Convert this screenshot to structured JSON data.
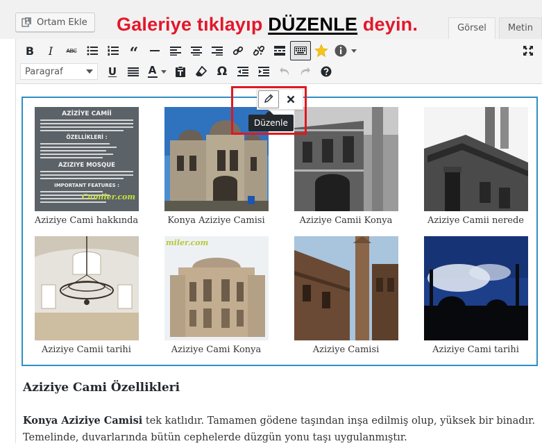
{
  "media_button": {
    "label": "Ortam Ekle",
    "icon": "media-icon"
  },
  "instruction": {
    "before": "Galeriye tıklayıp ",
    "keyword": "DÜZENLE",
    "after": " deyin."
  },
  "tabs": [
    {
      "label": "Görsel",
      "active": true
    },
    {
      "label": "Metin",
      "active": false
    }
  ],
  "toolbar": {
    "row1": [
      "bold",
      "italic",
      "strikethrough",
      "bullet-list",
      "numbered-list",
      "blockquote",
      "horizontal-line",
      "align-left",
      "align-center",
      "align-right",
      "insert-link",
      "remove-link",
      "read-more",
      "toolbar-toggle",
      "star",
      "info"
    ],
    "row2_format": "Paragraf",
    "row2": [
      "underline",
      "justify",
      "text-color",
      "paste-as-text",
      "clear-formatting",
      "special-character",
      "outdent",
      "indent",
      "undo",
      "redo",
      "help"
    ],
    "strike_glyph": "ABC",
    "omega_glyph": "Ω"
  },
  "gallery": {
    "items": [
      {
        "caption": "Aziziye Cami hakkında"
      },
      {
        "caption": "Konya Aziziye Camisi"
      },
      {
        "caption": "Aziziye Camii Konya"
      },
      {
        "caption": "Aziziye Camii nerede"
      },
      {
        "caption": "Aziziye Camii tarihi"
      },
      {
        "caption": "Aziziye Cami Konya"
      },
      {
        "caption": "Aziziye Camisi"
      },
      {
        "caption": "Aziziye Cami tarihi"
      }
    ],
    "photo1": {
      "title": "AZİZİYE CAMİİ",
      "sub1": "ÖZELLİKLERİ :",
      "mid": "AZIZIYE MOSQUE",
      "sub2": "IMPORTANT FEATURES :",
      "watermark": "Camiler.com"
    },
    "photo6_watermark": "miler.com",
    "edit_tool_tooltip": "Düzenle"
  },
  "content": {
    "heading": "Aziziye Cami Özellikleri",
    "para_bold": "Konya Aziziye Camisi",
    "para_rest": " tek katlıdır. Tamamen gödene taşından inşa edilmiş olup, yüksek bir binadır. Temelinde, duvarlarında bütün cephelerde düzgün yonu taşı uygulanmıştır."
  },
  "colors": {
    "instruction": "#e3172b",
    "gallery_border": "#2e8fc7",
    "highlight": "#e1171e",
    "star": "#f5c518"
  }
}
